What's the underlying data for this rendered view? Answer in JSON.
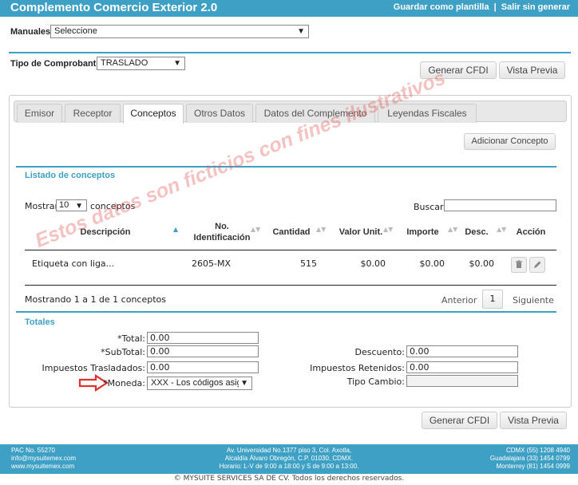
{
  "header": {
    "title": "Complemento Comercio Exterior 2.0",
    "save_template": "Guardar como plantilla",
    "separator": "|",
    "exit": "Salir sin generar"
  },
  "manuales": {
    "label": "Manuales:",
    "value": "Seleccione"
  },
  "tipo_comprobante": {
    "label": "Tipo de Comprobante:",
    "value": "TRASLADO"
  },
  "actions": {
    "generar": "Generar CFDI",
    "vista_previa": "Vista Previa"
  },
  "tabs": [
    {
      "label": "Emisor"
    },
    {
      "label": "Receptor"
    },
    {
      "label": "Conceptos"
    },
    {
      "label": "Otros Datos"
    },
    {
      "label": "Datos del Complemento"
    },
    {
      "label": "Leyendas Fiscales"
    }
  ],
  "conceptos": {
    "add_button": "Adicionar Concepto",
    "section_title": "Listado de conceptos",
    "show_label": "Mostrar",
    "show_value": "10",
    "show_suffix": "conceptos",
    "search_label": "Buscar:",
    "columns": {
      "descripcion": "Descripción",
      "no_ident_1": "No.",
      "no_ident_2": "Identificación",
      "cantidad": "Cantidad",
      "valor_unit": "Valor Unit.",
      "importe": "Importe",
      "desc": "Desc.",
      "accion": "Acción"
    },
    "rows": [
      {
        "descripcion": "Etiqueta con liga...",
        "no_ident": "2605-MX",
        "cantidad": "515",
        "valor_unit": "$0.00",
        "importe": "$0.00",
        "desc": "$0.00"
      }
    ],
    "info": "Mostrando 1 a 1 de 1 conceptos",
    "prev": "Anterior",
    "page": "1",
    "next": "Siguiente"
  },
  "totales": {
    "title": "Totales",
    "total_label": "*Total:",
    "total_value": "0.00",
    "subtotal_label": "*SubTotal:",
    "subtotal_value": "0.00",
    "imp_tras_label": "Impuestos Trasladados:",
    "imp_tras_value": "0.00",
    "moneda_label": "*Moneda:",
    "moneda_value": "XXX - Los códigos asign",
    "descuento_label": "Descuento:",
    "descuento_value": "0.00",
    "imp_ret_label": "Impuestos Retenidos:",
    "imp_ret_value": "0.00",
    "tipo_cambio_label": "Tipo Cambio:",
    "tipo_cambio_value": ""
  },
  "watermark": "Estos datos son ficticios con fines ilustrativos",
  "footer": {
    "left_1": "PAC No. 55270",
    "left_2": "info@mysuitemex.com",
    "left_3": "www.mysuitemex.com",
    "center_1": "Av. Universidad No.1377 piso 3, Col. Axotla,",
    "center_2": "Alcaldía Álvaro Obregón, C.P. 01030, CDMX.",
    "center_3": "Horario: L-V de 9:00 a 18:00 y S de 9:00 a 13:00.",
    "right_1": "CDMX (55) 1208 4940",
    "right_2": "Guadalajara (33) 1454 0799",
    "right_3": "Monterrey (81) 1454 0999",
    "copyright": "© MYSUITE SERVICES SA DE CV. Todos los derechos reservados."
  },
  "colors": {
    "accent": "#3ea0c4",
    "arrow": "#e03030",
    "watermark": "#e15050"
  }
}
